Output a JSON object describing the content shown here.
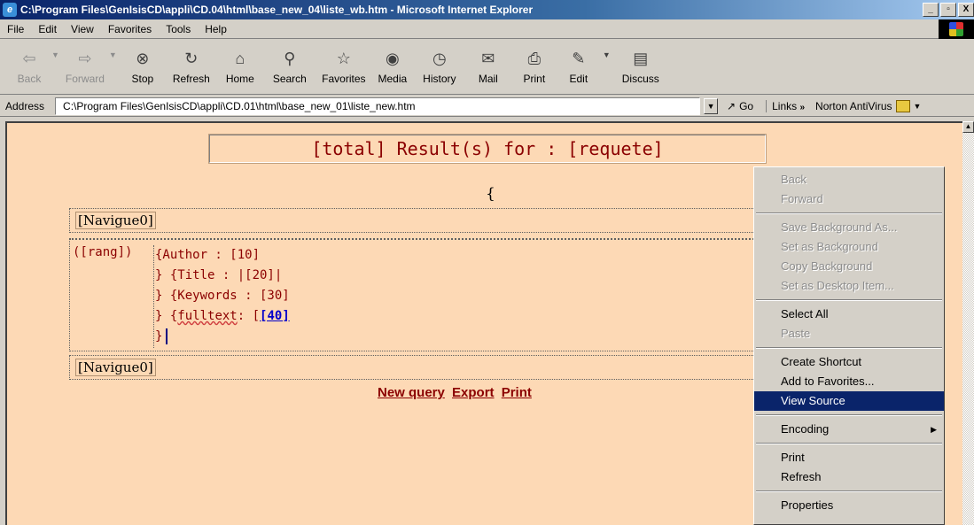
{
  "window": {
    "title": "C:\\Program Files\\GenIsisCD\\appli\\CD.04\\html\\base_new_04\\liste_wb.htm - Microsoft Internet Explorer",
    "minimize": "_",
    "maximize": "▫",
    "close": "X"
  },
  "menubar": {
    "items": [
      "File",
      "Edit",
      "View",
      "Favorites",
      "Tools",
      "Help"
    ]
  },
  "toolbar": {
    "back": "Back",
    "forward": "Forward",
    "stop": "Stop",
    "refresh": "Refresh",
    "home": "Home",
    "search": "Search",
    "favorites": "Favorites",
    "media": "Media",
    "history": "History",
    "mail": "Mail",
    "print": "Print",
    "edit": "Edit",
    "discuss": "Discuss"
  },
  "addressbar": {
    "label": "Address",
    "url": "C:\\Program Files\\GenIsisCD\\appli\\CD.01\\html\\base_new_01\\liste_new.htm",
    "go": "Go",
    "links": "Links",
    "norton": "Norton AntiVirus"
  },
  "page": {
    "result_title": "[total] Result(s) for : [requete]",
    "brace": "{",
    "navigue_top": "[Navigue0]",
    "navigue_bottom": "[Navigue0]",
    "rang": "([rang])",
    "field_author": "{Author : [10]",
    "field_title": "} {Title : |[20]|",
    "field_keywords": "} {Keywords : [30]",
    "field_fulltext_pre": "} {",
    "field_fulltext_word": "fulltext",
    "field_fulltext_mid": ": [",
    "field_fulltext_link": "[40]",
    "field_end": "}",
    "link_new_query": "New query",
    "link_export": "Export",
    "link_print": "Print"
  },
  "context_menu": {
    "back": "Back",
    "forward": "Forward",
    "save_background": "Save Background As...",
    "set_background": "Set as Background",
    "copy_background": "Copy Background",
    "set_desktop": "Set as Desktop Item...",
    "select_all": "Select All",
    "paste": "Paste",
    "create_shortcut": "Create Shortcut",
    "add_favorites": "Add to Favorites...",
    "view_source": "View Source",
    "encoding": "Encoding",
    "print": "Print",
    "refresh": "Refresh",
    "properties": "Properties"
  }
}
